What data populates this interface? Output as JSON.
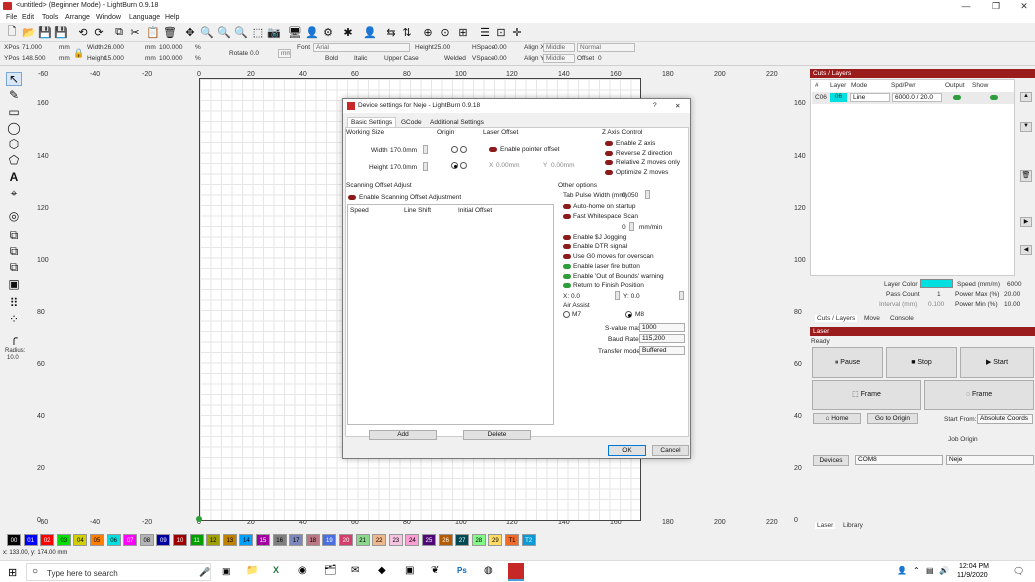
{
  "window": {
    "title": "<untitled> (Beginner Mode) - LightBurn 0.9.18",
    "min": "—",
    "max": "❐",
    "close": "✕"
  },
  "menu": [
    "File",
    "Edit",
    "Tools",
    "Arrange",
    "Window",
    "Language",
    "Help"
  ],
  "props": {
    "xpos_label": "XPos",
    "xpos": "71.000",
    "ypos_label": "YPos",
    "ypos": "148.500",
    "mm": "mm",
    "width_label": "Width",
    "width": "26.000",
    "height_label": "Height",
    "height": "15.000",
    "scale_w": "100.000",
    "scale_h": "100.000",
    "pct": "%",
    "rotate_label": "Rotate",
    "rotate": "0.0",
    "mm_btn": "mm",
    "font_label": "Font",
    "font": "Arial",
    "bold": "Bold",
    "italic": "Italic",
    "upper": "Upper Case",
    "welded": "Welded",
    "fheight_label": "Height",
    "fheight": "25.00",
    "hspace_label": "HSpace",
    "hspace": "0.00",
    "vspace_label": "VSpace",
    "vspace": "0.00",
    "alignx_label": "Align X",
    "alignx": "Middle",
    "aligny_label": "Align Y",
    "aligny": "Middle",
    "normal": "Normal",
    "offset_label": "Offset",
    "offset": "0"
  },
  "ruler": {
    "top": [
      "-60",
      "-40",
      "-20",
      "0",
      "20",
      "40",
      "60",
      "80",
      "100",
      "120",
      "140",
      "160",
      "180",
      "200",
      "220"
    ],
    "left": [
      "160",
      "140",
      "120",
      "100",
      "80",
      "60",
      "40",
      "20"
    ],
    "bottom": [
      "-60",
      "-40",
      "-20",
      "0",
      "20",
      "40",
      "60",
      "80",
      "100",
      "120",
      "140",
      "160",
      "180",
      "200",
      "220"
    ],
    "left_zero": "0"
  },
  "radius": {
    "label": "Radius:",
    "value": "10.0"
  },
  "palette": [
    {
      "l": "00",
      "c": "#000000",
      "f": "#fff"
    },
    {
      "l": "01",
      "c": "#0000ff",
      "f": "#fff"
    },
    {
      "l": "02",
      "c": "#ff0000",
      "f": "#fff"
    },
    {
      "l": "03",
      "c": "#00e000",
      "f": "#000"
    },
    {
      "l": "04",
      "c": "#d0d000",
      "f": "#000"
    },
    {
      "l": "05",
      "c": "#ff8000",
      "f": "#000"
    },
    {
      "l": "06",
      "c": "#00e0e0",
      "f": "#000"
    },
    {
      "l": "07",
      "c": "#ff00ff",
      "f": "#fff"
    },
    {
      "l": "08",
      "c": "#b4b4b4",
      "f": "#000"
    },
    {
      "l": "09",
      "c": "#0000a0",
      "f": "#fff"
    },
    {
      "l": "10",
      "c": "#a00000",
      "f": "#fff"
    },
    {
      "l": "11",
      "c": "#00a000",
      "f": "#fff"
    },
    {
      "l": "12",
      "c": "#a0a000",
      "f": "#000"
    },
    {
      "l": "13",
      "c": "#c08000",
      "f": "#000"
    },
    {
      "l": "14",
      "c": "#00a0ff",
      "f": "#000"
    },
    {
      "l": "15",
      "c": "#a000a0",
      "f": "#fff"
    },
    {
      "l": "16",
      "c": "#808080",
      "f": "#000"
    },
    {
      "l": "17",
      "c": "#7d87b9",
      "f": "#000"
    },
    {
      "l": "18",
      "c": "#bb7784",
      "f": "#000"
    },
    {
      "l": "19",
      "c": "#4a6fe3",
      "f": "#fff"
    },
    {
      "l": "20",
      "c": "#d33f6a",
      "f": "#fff"
    },
    {
      "l": "21",
      "c": "#8cd78c",
      "f": "#000"
    },
    {
      "l": "22",
      "c": "#f0b98d",
      "f": "#000"
    },
    {
      "l": "23",
      "c": "#f6c4e1",
      "f": "#000"
    },
    {
      "l": "24",
      "c": "#fa9ed4",
      "f": "#000"
    },
    {
      "l": "25",
      "c": "#500a78",
      "f": "#fff"
    },
    {
      "l": "26",
      "c": "#b45a00",
      "f": "#fff"
    },
    {
      "l": "27",
      "c": "#004754",
      "f": "#fff"
    },
    {
      "l": "28",
      "c": "#86fa88",
      "f": "#000"
    },
    {
      "l": "29",
      "c": "#ffdb66",
      "f": "#000"
    },
    {
      "l": "T1",
      "c": "#f36926",
      "f": "#000"
    },
    {
      "l": "T2",
      "c": "#0a9ad8",
      "f": "#fff"
    }
  ],
  "status": "x: 133.00, y: 174.00 mm",
  "taskbar": {
    "search": "Type here to search",
    "time": "12:04 PM",
    "date": "11/9/2020"
  },
  "cuts": {
    "title": "Cuts / Layers",
    "cols": [
      "#",
      "Layer",
      "Mode",
      "Spd/Pwr",
      "Output",
      "Show"
    ],
    "row": {
      "num": "C06",
      "layer": "06",
      "mode": "Line",
      "spdpwr": "6000.0 / 20.0"
    },
    "layer_color": "Layer Color",
    "speed_label": "Speed (mm/m)",
    "speed": "6000",
    "pass_label": "Pass Count",
    "pass": "1",
    "maxpow_label": "Power Max (%)",
    "maxpow": "20.00",
    "interval_label": "Interval (mm)",
    "interval": "0.100",
    "minpow_label": "Power Min (%)",
    "minpow": "10.00",
    "tabs": [
      "Cuts / Layers",
      "Move",
      "Console"
    ]
  },
  "laser": {
    "title": "Laser",
    "ready": "Ready",
    "pause": "Pause",
    "stop": "Stop",
    "start": "Start",
    "frame1": "Frame",
    "frame2": "Frame",
    "home": "Home",
    "goorigin": "Go to Origin",
    "startfrom_label": "Start From:",
    "startfrom": "Absolute Coords",
    "joborigin": "Job Origin",
    "devices": "Devices",
    "port": "COM8",
    "device": "Neje",
    "tabs": [
      "Laser",
      "Library"
    ]
  },
  "dialog": {
    "title": "Device settings for Neje - LightBurn 0.9.18",
    "help": "?",
    "close": "✕",
    "tabs": [
      "Basic Settings",
      "GCode",
      "Additional Settings"
    ],
    "working_size": "Working Size",
    "width_label": "Width",
    "width": "170.0mm",
    "height_label": "Height",
    "height": "170.0mm",
    "origin": "Origin",
    "laser_offset": "Laser Offset",
    "enable_pointer": "Enable pointer offset",
    "x_label": "X",
    "x": "0.00mm",
    "y_label": "Y",
    "y": "0.00mm",
    "zaxis": "Z Axis Control",
    "z_items": [
      "Enable Z axis",
      "Reverse Z direction",
      "Relative Z moves only",
      "Optimize Z moves"
    ],
    "scan_title": "Scanning Offset Adjust",
    "scan_enable": "Enable Scanning Offset Adjustment",
    "scan_cols": [
      "Speed",
      "Line Shift",
      "Initial Offset"
    ],
    "add": "Add",
    "delete": "Delete",
    "other": "Other options",
    "tab_pulse_label": "Tab Pulse Width (mm)",
    "tab_pulse": "0.050",
    "opts1": [
      "Auto-home on startup",
      "Fast Whitespace Scan"
    ],
    "mmmin_val": "0",
    "mmmin": "mm/min",
    "opts2": [
      "Enable $J Jogging",
      "Enable DTR signal",
      "Use G0 moves for overscan"
    ],
    "opts3": [
      "Enable laser fire button",
      "Enable 'Out of Bounds' warning",
      "Return to Finish Position"
    ],
    "retx": "X: 0.0",
    "rety": "Y: 0.0",
    "air": "Air Assist",
    "m7": "M7",
    "m8": "M8",
    "svalue_label": "S-value max",
    "svalue": "1000",
    "baud_label": "Baud Rate",
    "baud": "115,200",
    "transfer_label": "Transfer mode",
    "transfer": "Buffered",
    "ok": "OK",
    "cancel": "Cancel"
  }
}
